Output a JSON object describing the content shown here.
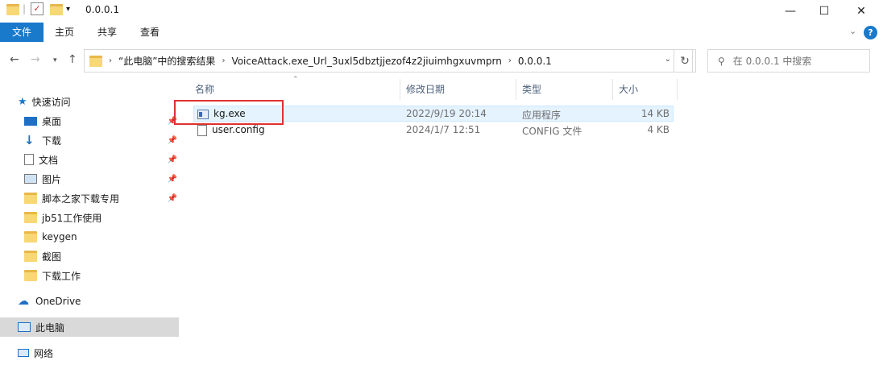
{
  "window": {
    "title": "0.0.0.1",
    "minimize": "—",
    "maximize": "☐",
    "close": "✕"
  },
  "ribbon": {
    "tabs": [
      "文件",
      "主页",
      "共享",
      "查看"
    ]
  },
  "address": {
    "crumbs": [
      "“此电脑”中的搜索结果",
      "VoiceAttack.exe_Url_3uxl5dbztjjezof4z2jiuimhgxuvmprn",
      "0.0.0.1"
    ],
    "search_placeholder": "在 0.0.0.1 中搜索"
  },
  "nav": {
    "quick_access": "快速访问",
    "items": [
      {
        "label": "桌面",
        "icon": "desktop-icon",
        "pinned": true
      },
      {
        "label": "下载",
        "icon": "download-icon",
        "pinned": true
      },
      {
        "label": "文档",
        "icon": "document-icon",
        "pinned": true
      },
      {
        "label": "图片",
        "icon": "pictures-icon",
        "pinned": true
      },
      {
        "label": "脚本之家下载专用",
        "icon": "folder-icon",
        "pinned": true
      },
      {
        "label": "jb51工作使用",
        "icon": "folder-icon",
        "pinned": false
      },
      {
        "label": "keygen",
        "icon": "folder-icon",
        "pinned": false
      },
      {
        "label": "截图",
        "icon": "folder-icon",
        "pinned": false
      },
      {
        "label": "下载工作",
        "icon": "folder-icon",
        "pinned": false
      }
    ],
    "onedrive": "OneDrive",
    "this_pc": "此电脑",
    "network": "网络"
  },
  "columns": [
    "名称",
    "修改日期",
    "类型",
    "大小"
  ],
  "files": [
    {
      "name": "kg.exe",
      "modified": "2022/9/19 20:14",
      "type": "应用程序",
      "size": "14 KB"
    },
    {
      "name": "user.config",
      "modified": "2024/1/7 12:51",
      "type": "CONFIG 文件",
      "size": "4 KB"
    }
  ],
  "colors": {
    "accent": "#1979ca",
    "highlight": "#e03131",
    "selection": "#e5f3ff"
  }
}
